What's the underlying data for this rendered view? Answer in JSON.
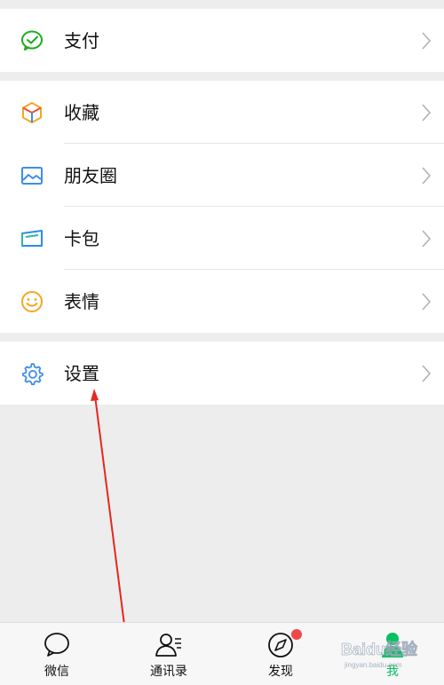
{
  "colors": {
    "accent_green": "#07c160",
    "background": "#ededed",
    "badge_red": "#f04848",
    "annotation_arrow": "#e8261f"
  },
  "groups": [
    {
      "items": [
        {
          "label": "支付",
          "icon": "wallet-check-icon"
        }
      ]
    },
    {
      "items": [
        {
          "label": "收藏",
          "icon": "cube-icon"
        },
        {
          "label": "朋友圈",
          "icon": "picture-icon"
        },
        {
          "label": "卡包",
          "icon": "card-icon"
        },
        {
          "label": "表情",
          "icon": "smiley-icon"
        }
      ]
    },
    {
      "items": [
        {
          "label": "设置",
          "icon": "gear-icon"
        }
      ]
    }
  ],
  "tabbar": {
    "tabs": [
      {
        "label": "微信",
        "icon": "chat-bubble-icon",
        "active": false
      },
      {
        "label": "通讯录",
        "icon": "contacts-icon",
        "active": false
      },
      {
        "label": "发现",
        "icon": "compass-icon",
        "active": false,
        "badge": true
      },
      {
        "label": "我",
        "icon": "person-icon",
        "active": true
      }
    ]
  },
  "watermark": {
    "text": "Baidu经验",
    "subtext": "jingyan.baidu.com"
  }
}
